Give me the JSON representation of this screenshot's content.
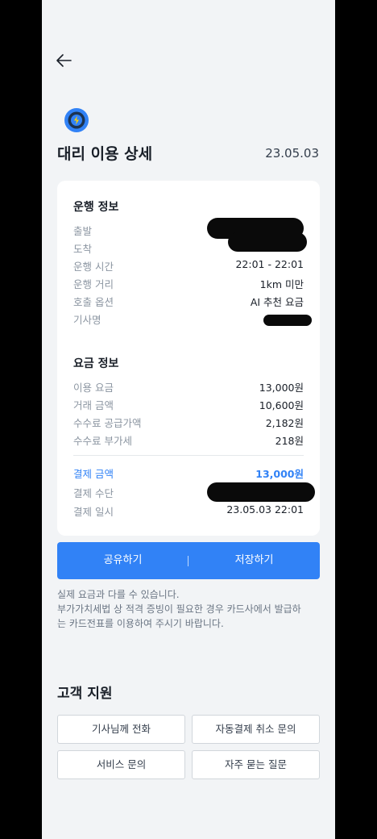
{
  "header": {
    "title": "대리 이용 상세",
    "date": "23.05.03"
  },
  "colors": {
    "accent": "#3182f6",
    "background": "#f2f4f6",
    "card": "#ffffff"
  },
  "icons": {
    "back": "arrow-left-icon",
    "logo": "steering-wheel-icon"
  },
  "drive_info": {
    "title": "운행 정보",
    "rows": [
      {
        "label": "출발",
        "value": ""
      },
      {
        "label": "도착",
        "value": ""
      },
      {
        "label": "운행 시간",
        "value": "22:01 - 22:01"
      },
      {
        "label": "운행 거리",
        "value": "1km 미만"
      },
      {
        "label": "호출 옵션",
        "value": "AI 추천 요금"
      },
      {
        "label": "기사명",
        "value": ""
      }
    ]
  },
  "fare_info": {
    "title": "요금 정보",
    "rows": [
      {
        "label": "이용 요금",
        "value": "13,000원"
      },
      {
        "label": "거래 금액",
        "value": "10,600원"
      },
      {
        "label": "수수료 공급가액",
        "value": "2,182원"
      },
      {
        "label": "수수료 부가세",
        "value": "218원"
      }
    ],
    "payment_rows": [
      {
        "label": "결제 금액",
        "value": "13,000원"
      },
      {
        "label": "결제 수단",
        "value": ""
      },
      {
        "label": "결제 일시",
        "value": "23.05.03 22:01"
      }
    ]
  },
  "actions": {
    "share": "공유하기",
    "save": "저장하기",
    "separator": "|"
  },
  "notice": [
    "실제 요금과 다를 수 있습니다.",
    "부가가치세법 상 적격 증빙이 필요한 경우 카드사에서 발급하",
    "는 카드전표를 이용하여 주시기 바랍니다."
  ],
  "support": {
    "title": "고객 지원",
    "buttons": [
      "기사님께 전화",
      "자동결제 취소 문의",
      "서비스 문의",
      "자주 묻는 질문"
    ]
  }
}
